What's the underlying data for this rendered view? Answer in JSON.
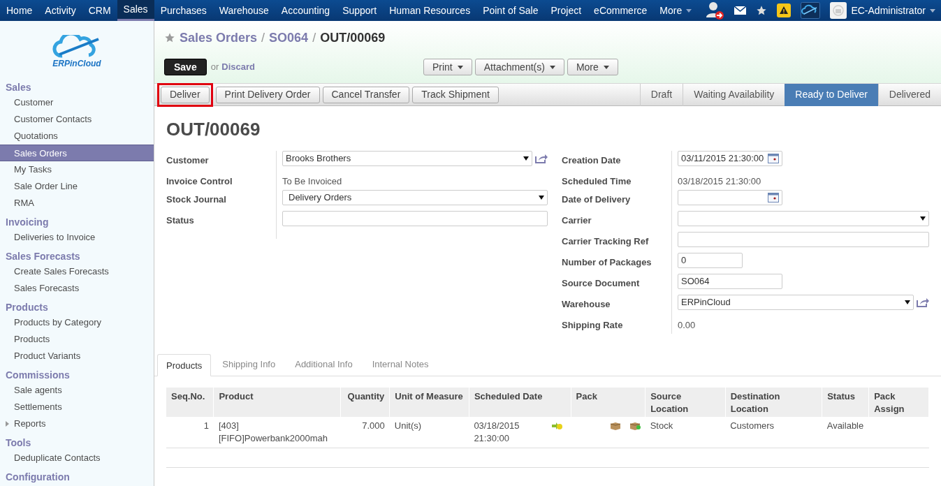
{
  "top_menu": {
    "items": [
      {
        "label": "Home",
        "selected": false
      },
      {
        "label": "Activity",
        "selected": false
      },
      {
        "label": "CRM",
        "selected": false
      },
      {
        "label": "Sales",
        "selected": true
      },
      {
        "label": "Purchases",
        "selected": false
      },
      {
        "label": "Warehouse",
        "selected": false
      },
      {
        "label": "Accounting",
        "selected": false
      },
      {
        "label": "Support",
        "selected": false
      },
      {
        "label": "Human Resources",
        "selected": false
      },
      {
        "label": "Point of Sale",
        "selected": false
      },
      {
        "label": "Project",
        "selected": false
      },
      {
        "label": "eCommerce",
        "selected": false
      }
    ],
    "more": "More",
    "user": "EC-Administrator"
  },
  "logo": {
    "text": "ERPinCloud"
  },
  "sidebar": [
    {
      "title": "Sales",
      "items": [
        {
          "label": "Customer",
          "selected": false,
          "kind": "link"
        },
        {
          "label": "Customer Contacts",
          "selected": false,
          "kind": "link"
        },
        {
          "label": "Quotations",
          "selected": false,
          "kind": "link"
        },
        {
          "label": "Sales Orders",
          "selected": true,
          "kind": "link"
        },
        {
          "label": "My Tasks",
          "selected": false,
          "kind": "link"
        },
        {
          "label": "Sale Order Line",
          "selected": false,
          "kind": "link"
        },
        {
          "label": "RMA",
          "selected": false,
          "kind": "link"
        }
      ]
    },
    {
      "title": "Invoicing",
      "items": [
        {
          "label": "Deliveries to Invoice",
          "selected": false,
          "kind": "link"
        }
      ]
    },
    {
      "title": "Sales Forecasts",
      "items": [
        {
          "label": "Create Sales Forecasts",
          "selected": false,
          "kind": "link"
        },
        {
          "label": "Sales Forecasts",
          "selected": false,
          "kind": "link"
        }
      ]
    },
    {
      "title": "Products",
      "items": [
        {
          "label": "Products by Category",
          "selected": false,
          "kind": "link"
        },
        {
          "label": "Products",
          "selected": false,
          "kind": "link"
        },
        {
          "label": "Product Variants",
          "selected": false,
          "kind": "link"
        }
      ]
    },
    {
      "title": "Commissions",
      "items": [
        {
          "label": "Sale agents",
          "selected": false,
          "kind": "link"
        },
        {
          "label": "Settlements",
          "selected": false,
          "kind": "link"
        },
        {
          "label": "Reports",
          "selected": false,
          "kind": "folder"
        }
      ]
    },
    {
      "title": "Tools",
      "items": [
        {
          "label": "Deduplicate Contacts",
          "selected": false,
          "kind": "link"
        }
      ]
    },
    {
      "title": "Configuration"
    }
  ],
  "breadcrumb": [
    {
      "label": "Sales Orders",
      "kind": "link"
    },
    {
      "label": "/",
      "kind": "separator"
    },
    {
      "label": "SO064",
      "kind": "link"
    },
    {
      "label": "/",
      "kind": "separator"
    },
    {
      "label": "OUT/00069",
      "kind": "current"
    }
  ],
  "save": "Save",
  "or": "or",
  "discard": "Discard",
  "menus": [
    "Print",
    "Attachment(s)",
    "More"
  ],
  "actions": [
    {
      "label": "Deliver",
      "highlighted": true
    },
    {
      "label": "Print Delivery Order",
      "highlighted": false
    },
    {
      "label": "Cancel Transfer",
      "highlighted": false
    },
    {
      "label": "Track Shipment",
      "highlighted": false
    }
  ],
  "stages": [
    {
      "label": "Draft",
      "selected": false
    },
    {
      "label": "Waiting Availability",
      "selected": false
    },
    {
      "label": "Ready to Deliver",
      "selected": true
    },
    {
      "label": "Delivered",
      "selected": false
    }
  ],
  "title": "OUT/00069",
  "left_fields": [
    {
      "label": "Customer",
      "kind": "many2one",
      "value": "Brooks Brothers"
    },
    {
      "label": "Invoice Control",
      "kind": "text",
      "value": "To Be Invoiced"
    },
    {
      "label": "Stock Journal",
      "kind": "select",
      "value": "Delivery Orders"
    },
    {
      "label": "Status",
      "kind": "input"
    }
  ],
  "right_fields": [
    {
      "label": "Creation Date",
      "kind": "date",
      "value": "03/11/2015 21:30:00"
    },
    {
      "label": "Scheduled Time",
      "kind": "text",
      "value": "03/18/2015 21:30:00"
    },
    {
      "label": "Date of Delivery",
      "kind": "date"
    },
    {
      "label": "Carrier",
      "kind": "select"
    },
    {
      "label": "Carrier Tracking Ref",
      "kind": "input"
    },
    {
      "label": "Number of Packages",
      "kind": "number",
      "value": "0"
    },
    {
      "label": "Source Document",
      "kind": "short",
      "value": "SO064"
    },
    {
      "label": "Warehouse",
      "kind": "many2one",
      "value": "ERPinCloud"
    },
    {
      "label": "Shipping Rate",
      "kind": "text",
      "value": "0.00"
    }
  ],
  "tabs": [
    {
      "label": "Products",
      "selected": true
    },
    {
      "label": "Shipping Info",
      "selected": false
    },
    {
      "label": "Additional Info",
      "selected": false
    },
    {
      "label": "Internal Notes",
      "selected": false
    }
  ],
  "table": {
    "columns": [
      "Seq.No.",
      "Product",
      "Quantity",
      "Unit of Measure",
      "Scheduled Date",
      "Pack",
      "Source Location",
      "Destination Location",
      "Status",
      "Pack Assign"
    ],
    "rows": [
      {
        "seq": "1",
        "product": "[403] [FIFO]Powerbank2000mah",
        "quantity": "7.000",
        "uom": "Unit(s)",
        "scheduled_date": "03/18/2015 21:30:00",
        "source": "Stock",
        "destination": "Customers",
        "status": "Available"
      }
    ]
  }
}
